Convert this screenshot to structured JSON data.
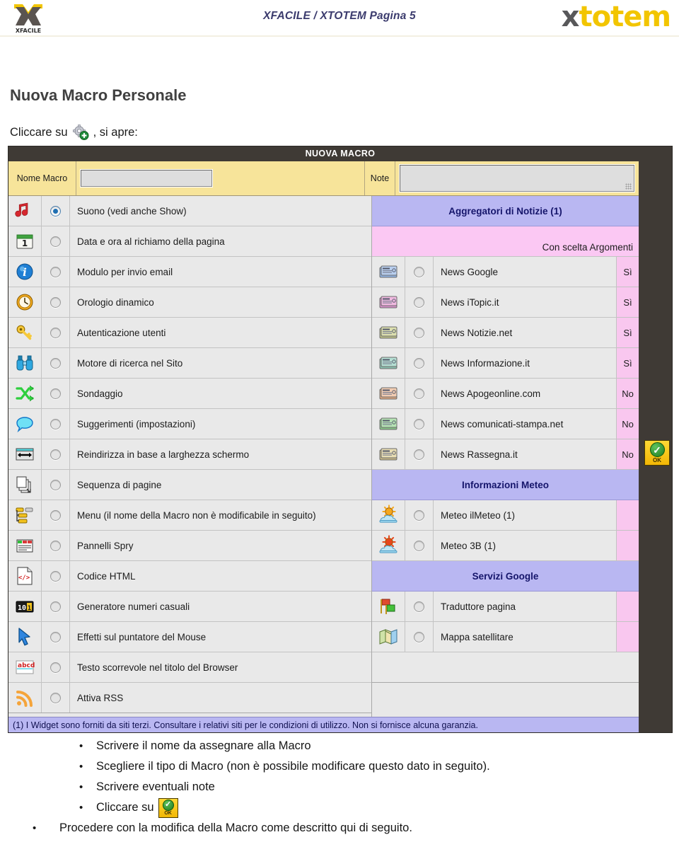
{
  "header": {
    "brand_left": "XFACILE",
    "title": "XFACILE / XTOTEM Pagina 5",
    "brand_right_x": "x",
    "brand_right_rest": "totem"
  },
  "document": {
    "title": "Nuova Macro Personale",
    "intro_before": "Cliccare su",
    "intro_after": ", si apre:"
  },
  "dialog": {
    "titlebar": "NUOVA MACRO",
    "name_label": "Nome Macro",
    "name_value": "",
    "note_label": "Note",
    "note_value": "",
    "footnote": "(1) I Widget sono forniti da siti terzi. Consultare i relativi siti per le condizioni di utilizzo. Non si fornisce alcuna garanzia.",
    "ok_label": "OK",
    "left_options": [
      {
        "icon": "music-note-icon",
        "label": "Suono (vedi anche Show)",
        "selected": true
      },
      {
        "icon": "calendar-icon",
        "label": "Data e ora al richiamo della pagina",
        "selected": false
      },
      {
        "icon": "info-icon",
        "label": "Modulo per invio email",
        "selected": false
      },
      {
        "icon": "clock-icon",
        "label": "Orologio dinamico",
        "selected": false
      },
      {
        "icon": "key-icon",
        "label": "Autenticazione utenti",
        "selected": false
      },
      {
        "icon": "binoculars-icon",
        "label": "Motore di ricerca nel Sito",
        "selected": false
      },
      {
        "icon": "shuffle-arrows-icon",
        "label": "Sondaggio",
        "selected": false
      },
      {
        "icon": "speech-bubble-icon",
        "label": "Suggerimenti (impostazioni)",
        "selected": false
      },
      {
        "icon": "resize-width-icon",
        "label": "Reindirizza in base a larghezza schermo",
        "selected": false
      },
      {
        "icon": "pages-stack-icon",
        "label": "Sequenza di pagine",
        "selected": false
      },
      {
        "icon": "menu-list-icon",
        "label": "Menu (il nome della Macro non è modificabile in seguito)",
        "selected": false
      },
      {
        "icon": "spry-panels-icon",
        "label": "Pannelli Spry",
        "selected": false
      },
      {
        "icon": "html-code-icon",
        "label": "Codice HTML",
        "selected": false
      },
      {
        "icon": "counter-digits-icon",
        "label": "Generatore numeri casuali",
        "selected": false
      },
      {
        "icon": "mouse-cursor-icon",
        "label": "Effetti sul puntatore del Mouse",
        "selected": false
      },
      {
        "icon": "scrolling-text-icon",
        "label": "Testo scorrevole nel titolo del Browser",
        "selected": false
      },
      {
        "icon": "rss-icon",
        "label": "Attiva RSS",
        "selected": false
      }
    ],
    "right_rows": [
      {
        "kind": "section",
        "label": "Aggregatori di Notizie (1)"
      },
      {
        "kind": "subhead",
        "label": "Con scelta Argomenti"
      },
      {
        "kind": "option",
        "icon": "newspaper-blue-icon",
        "label": "News Google",
        "flag": "Sì",
        "selected": false
      },
      {
        "kind": "option",
        "icon": "newspaper-pink-icon",
        "label": "News iTopic.it",
        "flag": "Sì",
        "selected": false
      },
      {
        "kind": "option",
        "icon": "newspaper-olive-icon",
        "label": "News Notizie.net",
        "flag": "Sì",
        "selected": false
      },
      {
        "kind": "option",
        "icon": "newspaper-teal-icon",
        "label": "News Informazione.it",
        "flag": "Sì",
        "selected": false
      },
      {
        "kind": "option",
        "icon": "newspaper-peach-icon",
        "label": "News Apogeonline.com",
        "flag": "No",
        "selected": false
      },
      {
        "kind": "option",
        "icon": "newspaper-green-icon",
        "label": "News comunicati-stampa.net",
        "flag": "No",
        "selected": false
      },
      {
        "kind": "option",
        "icon": "newspaper-tan-icon",
        "label": "News Rassegna.it",
        "flag": "No",
        "selected": false
      },
      {
        "kind": "section",
        "label": "Informazioni Meteo"
      },
      {
        "kind": "option",
        "icon": "weather-sun-cloud-icon",
        "label": "Meteo ilMeteo (1)",
        "flag": "",
        "selected": false
      },
      {
        "kind": "option",
        "icon": "weather-sun-cloud-red-icon",
        "label": "Meteo 3B (1)",
        "flag": "",
        "selected": false
      },
      {
        "kind": "section",
        "label": "Servizi Google"
      },
      {
        "kind": "option",
        "icon": "flags-translate-icon",
        "label": "Traduttore pagina",
        "flag": "",
        "selected": false
      },
      {
        "kind": "option",
        "icon": "map-icon",
        "label": "Mappa satellitare",
        "flag": "",
        "selected": false
      },
      {
        "kind": "filler",
        "label": ""
      }
    ]
  },
  "bullets": [
    {
      "text": "Scrivere il nome da assegnare alla Macro",
      "level": "inner",
      "icon": ""
    },
    {
      "text": "Scegliere il tipo di Macro (non è possibile modificare questo dato in seguito).",
      "level": "inner",
      "icon": ""
    },
    {
      "text": "Scrivere eventuali note",
      "level": "inner",
      "icon": ""
    },
    {
      "text": "Cliccare su",
      "level": "inner",
      "icon": "ok-button-icon"
    },
    {
      "text": "Procedere con la modifica della Macro come descritto qui di seguito.",
      "level": "outer",
      "icon": ""
    }
  ],
  "colors": {
    "titlebar": "#3f3a35",
    "yellow_bar": "#f7e49a",
    "section_header": "#b9b7f2",
    "subhead_pink": "#fbc8f3",
    "row_bg": "#e9e9e9",
    "accent_yellow": "#f2c500"
  }
}
